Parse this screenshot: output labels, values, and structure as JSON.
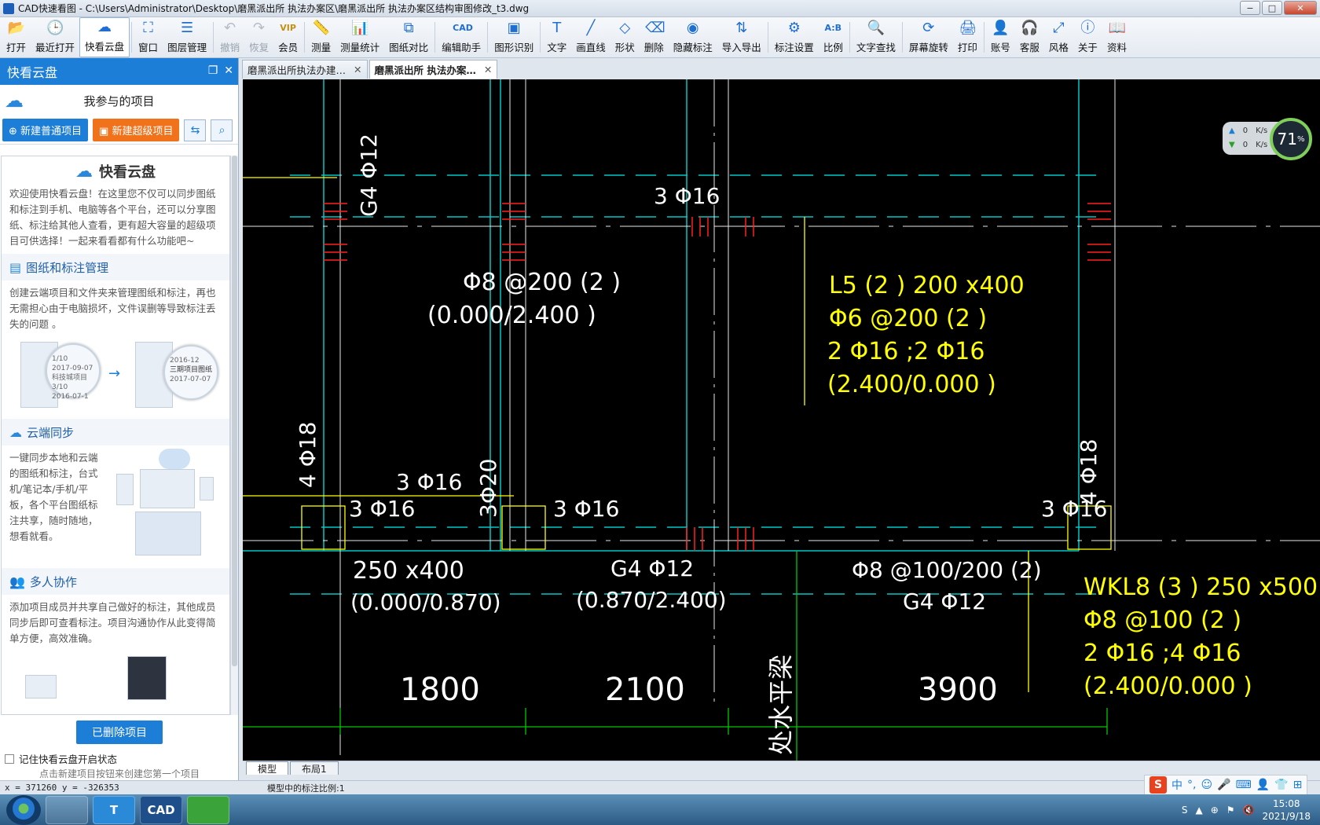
{
  "window": {
    "title": "CAD快速看图 - C:\\Users\\Administrator\\Desktop\\磨黑派出所 执法办案区\\磨黑派出所 执法办案区结构审图修改_t3.dwg",
    "buttons": {
      "minimize": "−",
      "maximize": "□",
      "close": "✕"
    }
  },
  "toolbar": [
    {
      "label": "打开",
      "icon": "folder-icon",
      "glyph": "📂",
      "state": "normal"
    },
    {
      "label": "最近打开",
      "icon": "clock-icon",
      "glyph": "🕒",
      "state": "normal"
    },
    {
      "label": "快看云盘",
      "icon": "cloud-icon",
      "glyph": "☁",
      "state": "active"
    },
    {
      "label": "窗口",
      "icon": "window-icon",
      "glyph": "⛶",
      "state": "normal"
    },
    {
      "label": "图层管理",
      "icon": "layers-icon",
      "glyph": "☰",
      "state": "normal"
    },
    {
      "label": "撤销",
      "icon": "undo-icon",
      "glyph": "↶",
      "state": "disabled"
    },
    {
      "label": "恢复",
      "icon": "redo-icon",
      "glyph": "↷",
      "state": "disabled"
    },
    {
      "label": "会员",
      "icon": "vip-icon",
      "glyph": "VIP",
      "state": "vip"
    },
    {
      "label": "测量",
      "icon": "ruler-icon",
      "glyph": "📏",
      "state": "normal"
    },
    {
      "label": "测量统计",
      "icon": "stats-icon",
      "glyph": "📊",
      "state": "normal"
    },
    {
      "label": "图纸对比",
      "icon": "compare-icon",
      "glyph": "⧉",
      "state": "normal"
    },
    {
      "label": "编辑助手",
      "icon": "edit-helper-icon",
      "glyph": "CAD",
      "state": "normal"
    },
    {
      "label": "图形识别",
      "icon": "shape-recognize-icon",
      "glyph": "▣",
      "state": "normal"
    },
    {
      "label": "文字",
      "icon": "text-icon",
      "glyph": "T",
      "state": "normal"
    },
    {
      "label": "画直线",
      "icon": "line-icon",
      "glyph": "╱",
      "state": "normal"
    },
    {
      "label": "形状",
      "icon": "shape-icon",
      "glyph": "◇",
      "state": "normal"
    },
    {
      "label": "删除",
      "icon": "eraser-icon",
      "glyph": "⌫",
      "state": "normal"
    },
    {
      "label": "隐藏标注",
      "icon": "eye-hide-icon",
      "glyph": "◉",
      "state": "normal"
    },
    {
      "label": "导入导出",
      "icon": "import-export-icon",
      "glyph": "⇅",
      "state": "normal"
    },
    {
      "label": "标注设置",
      "icon": "settings-icon",
      "glyph": "⚙",
      "state": "normal"
    },
    {
      "label": "比例",
      "icon": "scale-icon",
      "glyph": "A:B",
      "state": "normal"
    },
    {
      "label": "文字查找",
      "icon": "text-search-icon",
      "glyph": "🔍",
      "state": "normal"
    },
    {
      "label": "屏幕旋转",
      "icon": "rotate-icon",
      "glyph": "⟳",
      "state": "normal"
    },
    {
      "label": "打印",
      "icon": "print-icon",
      "glyph": "🖨",
      "state": "normal"
    },
    {
      "label": "账号",
      "icon": "user-icon",
      "glyph": "👤",
      "state": "normal"
    },
    {
      "label": "客服",
      "icon": "headset-icon",
      "glyph": "🎧",
      "state": "normal"
    },
    {
      "label": "风格",
      "icon": "style-icon",
      "glyph": "⤢",
      "state": "normal"
    },
    {
      "label": "关于",
      "icon": "info-icon",
      "glyph": "ⓘ",
      "state": "normal"
    },
    {
      "label": "资料",
      "icon": "book-icon",
      "glyph": "📖",
      "state": "normal"
    }
  ],
  "panel": {
    "title": "快看云盘",
    "my_projects": "我参与的项目",
    "new_normal": "新建普通项目",
    "new_super": "新建超级项目",
    "content_title": "快看云盘",
    "intro": "欢迎使用快看云盘！在这里您不仅可以同步图纸和标注到手机、电脑等各个平台，还可以分享图纸、标注给其他人查看，更有超大容量的超级项目可供选择！一起来看看都有什么功能吧~",
    "sections": [
      {
        "title": "图纸和标注管理",
        "text": "创建云端项目和文件夹来管理图纸和标注，再也无需担心由于电脑损坏，文件误删等导致标注丢失的问题 。"
      },
      {
        "title": "云端同步",
        "text": "一键同步本地和云端的图纸和标注，台式机/笔记本/手机/平板，各个平台图纸标注共享，随时随地，想看就看。"
      },
      {
        "title": "多人协作",
        "text": "添加项目成员并共享自己做好的标注，其他成员同步后即可查看标注。项目沟通协作从此变得简单方便，高效准确。"
      }
    ],
    "illus": {
      "left_lines": [
        "1/10",
        "2017-09-07",
        "科技城项目",
        "3/10",
        "2016-07-1"
      ],
      "right_lines": [
        "2016-12",
        "三期项目图纸",
        "2017-07-07"
      ]
    },
    "deleted_btn": "已删除项目",
    "remember": "记住快看云盘开启状态",
    "hint": "点击新建项目按钮来创建您第一个项目"
  },
  "tabs": [
    {
      "label": "磨黑派出所执法办建…",
      "active": false
    },
    {
      "label": "磨黑派出所 执法办案…",
      "active": true
    }
  ],
  "drawing": {
    "white_texts": [
      "3 Φ16",
      "Φ8 @200 (2 )",
      "(0.000/2.400 )",
      "G4 Φ12",
      "4 Φ18",
      "3 Φ16",
      "3 Φ16",
      "3Φ20",
      "3 Φ16",
      "3 Φ16",
      "4 Φ18",
      "250 x400",
      "(0.000/0.870)",
      "G4 Φ12",
      "(0.870/2.400)",
      "Φ8 @100/200 (2)",
      "G4 Φ12",
      "1800",
      "2100",
      "3900",
      "处水平梁"
    ],
    "yellow_texts": [
      "L5 (2 ) 200 x400",
      "Φ6 @200 (2 )",
      "2 Φ16 ;2 Φ16",
      "(2.400/0.000 )",
      "WKL8 (3 ) 250 x500",
      "Φ8 @100 (2 )",
      "2 Φ16 ;4 Φ16",
      "(2.400/0.000 )"
    ]
  },
  "model_tabs": [
    "模型",
    "布局1"
  ],
  "status": {
    "coords": "x = 371260 y = -326353",
    "scale": "模型中的标注比例:1"
  },
  "network": {
    "up": "0",
    "down": "0",
    "unit": "K/s",
    "percent": "71",
    "pct_sign": "%"
  },
  "taskbar": {
    "time": "15:08",
    "date": "2021/9/18",
    "apps": [
      "",
      "T",
      "CAD",
      ""
    ]
  },
  "ime": {
    "brand": "S",
    "lang": "中",
    "punct": "°,"
  },
  "colors": {
    "accent": "#1c7ed6",
    "orange": "#f0731c",
    "cad_yellow": "#ffff00",
    "cad_cyan": "#00cfcf",
    "cad_green": "#00c800",
    "cad_red": "#ff2020"
  }
}
